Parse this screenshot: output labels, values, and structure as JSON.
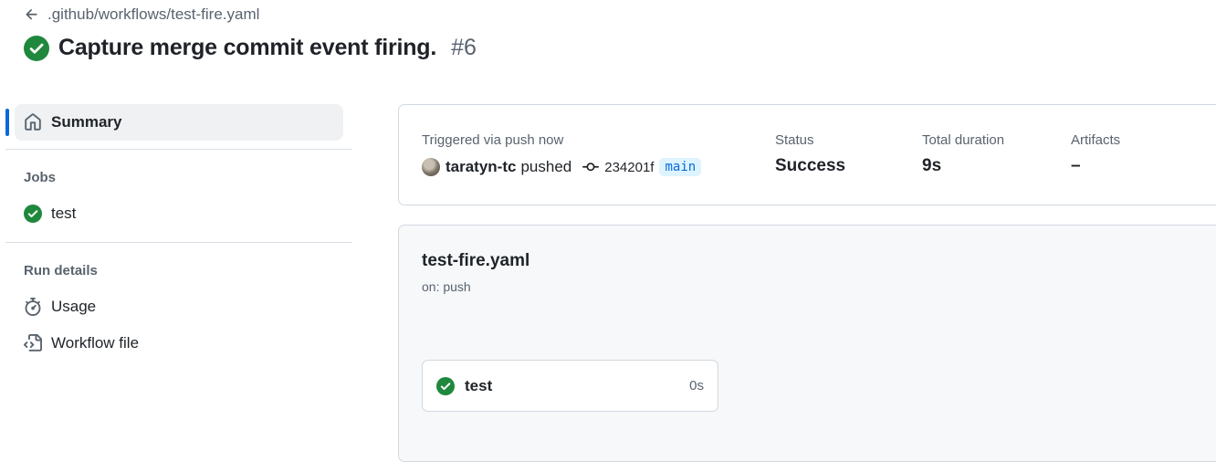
{
  "header": {
    "workflow_path": ".github/workflows/test-fire.yaml",
    "run_title": "Capture merge commit event firing.",
    "run_number": "#6",
    "status_color": "#1f883d"
  },
  "sidebar": {
    "summary_label": "Summary",
    "jobs_heading": "Jobs",
    "jobs": [
      {
        "label": "test",
        "status": "success"
      }
    ],
    "run_details_heading": "Run details",
    "run_details": [
      {
        "label": "Usage",
        "icon": "stopwatch-icon"
      },
      {
        "label": "Workflow file",
        "icon": "file-code-icon"
      }
    ]
  },
  "run_summary": {
    "trigger_label": "Triggered via push now",
    "actor": "taratyn-tc",
    "action": "pushed",
    "commit_sha": "234201f",
    "branch": "main",
    "status_label": "Status",
    "status_value": "Success",
    "duration_label": "Total duration",
    "duration_value": "9s",
    "artifacts_label": "Artifacts",
    "artifacts_value": "–"
  },
  "graph": {
    "workflow_file": "test-fire.yaml",
    "trigger": "on: push",
    "job": {
      "name": "test",
      "duration": "0s"
    }
  }
}
